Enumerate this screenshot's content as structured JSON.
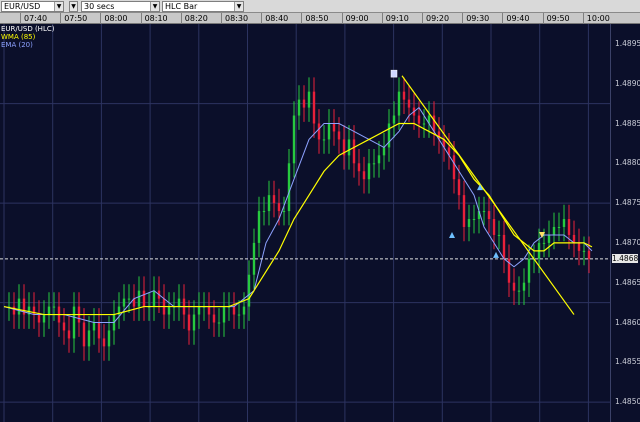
{
  "toolbar": {
    "symbol": "EUR/USD",
    "interval": "30 secs",
    "chart_style": "HLC Bar"
  },
  "legend": [
    {
      "label": "EUR/USD (HLC)",
      "color": "#ffffff"
    },
    {
      "label": "WMA (85)",
      "color": "#ffff00"
    },
    {
      "label": "EMA (20)",
      "color": "#8da2ff"
    }
  ],
  "current_price": "1.4868",
  "chart_data": {
    "type": "line",
    "time_labels": [
      "07:40",
      "07:50",
      "08:00",
      "08:10",
      "08:20",
      "08:30",
      "08:40",
      "08:50",
      "09:00",
      "09:10",
      "09:20",
      "09:30",
      "09:40",
      "09:50",
      "10:00"
    ],
    "price_labels": [
      "1.4895",
      "1.4890",
      "1.4885",
      "1.4880",
      "1.4875",
      "1.4870",
      "1.4865",
      "1.4860",
      "1.4855",
      "1.4850"
    ],
    "ylim": [
      1.48475,
      1.48975
    ],
    "series": [
      {
        "name": "EUR/USD (HLC)",
        "color": "#ffffff",
        "x": [
          0,
          5,
          10,
          15,
          20,
          25,
          30,
          35,
          40,
          45,
          50,
          55,
          60,
          65,
          70,
          75,
          80,
          85,
          90,
          95,
          100,
          105,
          110,
          115,
          120,
          125,
          130,
          135,
          140,
          145,
          150,
          155,
          160,
          165,
          170,
          175,
          180,
          185,
          190,
          195,
          200,
          205,
          210,
          215,
          220,
          225,
          230,
          235,
          240,
          245,
          250,
          255,
          260,
          265,
          270,
          275,
          280,
          285,
          290,
          295,
          300,
          305,
          310,
          315,
          320,
          325,
          330,
          335,
          340,
          345,
          350,
          355,
          360,
          365,
          370,
          375,
          380,
          385,
          390,
          395,
          400,
          405,
          410,
          415,
          420,
          425,
          430,
          435,
          440,
          445,
          450,
          455,
          460,
          465,
          470,
          475,
          480,
          485,
          490,
          495,
          500,
          505,
          510,
          515,
          520,
          525,
          530,
          535,
          540,
          545,
          550,
          555,
          560,
          565,
          570,
          575,
          580,
          585
        ],
        "y": [
          1.4862,
          1.4862,
          1.4861,
          1.4863,
          1.4861,
          1.4862,
          1.4861,
          1.486,
          1.4861,
          1.4862,
          1.4862,
          1.486,
          1.4859,
          1.4858,
          1.4862,
          1.486,
          1.4857,
          1.4859,
          1.486,
          1.4858,
          1.4857,
          1.4859,
          1.4861,
          1.4862,
          1.4863,
          1.4863,
          1.4862,
          1.4864,
          1.4862,
          1.4862,
          1.4864,
          1.4863,
          1.4861,
          1.4862,
          1.4862,
          1.4863,
          1.4861,
          1.4859,
          1.4861,
          1.4862,
          1.4862,
          1.4861,
          1.486,
          1.486,
          1.4862,
          1.4862,
          1.4861,
          1.4861,
          1.4862,
          1.4866,
          1.487,
          1.4874,
          1.4874,
          1.4876,
          1.4875,
          1.4874,
          1.4874,
          1.488,
          1.4886,
          1.4888,
          1.4887,
          1.4889,
          1.4885,
          1.4883,
          1.4883,
          1.4885,
          1.4884,
          1.4883,
          1.4881,
          1.4883,
          1.488,
          1.4879,
          1.4878,
          1.488,
          1.488,
          1.4881,
          1.4882,
          1.4885,
          1.4886,
          1.4889,
          1.4888,
          1.4887,
          1.4886,
          1.4885,
          1.4885,
          1.4886,
          1.4884,
          1.4883,
          1.4882,
          1.4881,
          1.4878,
          1.4876,
          1.4872,
          1.4873,
          1.4873,
          1.4874,
          1.4874,
          1.4873,
          1.4871,
          1.4871,
          1.4868,
          1.4865,
          1.4864,
          1.4864,
          1.4865,
          1.4868,
          1.4868,
          1.487,
          1.487,
          1.4871,
          1.4872,
          1.4872,
          1.4873,
          1.4871,
          1.487,
          1.4869,
          1.4869,
          1.4868
        ]
      },
      {
        "name": "WMA (85)",
        "color": "#ffff00",
        "x": [
          0,
          40,
          80,
          110,
          140,
          170,
          200,
          225,
          245,
          260,
          275,
          290,
          305,
          320,
          335,
          350,
          365,
          380,
          395,
          410,
          425,
          440,
          455,
          470,
          485,
          500,
          510,
          520,
          530,
          540,
          550,
          560,
          570,
          580,
          588
        ],
        "y": [
          1.4862,
          1.4861,
          1.4861,
          1.4861,
          1.4862,
          1.4862,
          1.4862,
          1.4862,
          1.4863,
          1.4866,
          1.4869,
          1.4873,
          1.4876,
          1.4879,
          1.4881,
          1.4882,
          1.4883,
          1.4884,
          1.4885,
          1.4885,
          1.4884,
          1.4883,
          1.4881,
          1.4878,
          1.4876,
          1.4873,
          1.4871,
          1.487,
          1.4869,
          1.4869,
          1.487,
          1.487,
          1.487,
          1.487,
          1.48695
        ]
      },
      {
        "name": "EMA (20)",
        "color": "#8da2ff",
        "x": [
          0,
          30,
          60,
          90,
          110,
          130,
          150,
          170,
          190,
          210,
          230,
          250,
          262,
          275,
          290,
          305,
          320,
          335,
          350,
          365,
          380,
          395,
          405,
          415,
          425,
          440,
          455,
          470,
          480,
          490,
          500,
          510,
          520,
          530,
          540,
          550,
          560,
          570,
          580,
          588
        ],
        "y": [
          1.4862,
          1.4861,
          1.4861,
          1.486,
          1.486,
          1.4863,
          1.4864,
          1.4862,
          1.4862,
          1.4862,
          1.4862,
          1.4864,
          1.487,
          1.4873,
          1.4878,
          1.4883,
          1.4885,
          1.4885,
          1.4884,
          1.4883,
          1.4882,
          1.4884,
          1.4886,
          1.4887,
          1.4885,
          1.4882,
          1.4879,
          1.4876,
          1.4872,
          1.487,
          1.4868,
          1.4867,
          1.4868,
          1.487,
          1.4871,
          1.4871,
          1.4871,
          1.487,
          1.487,
          1.4869
        ]
      },
      {
        "name": "trendline",
        "color": "#ffff00",
        "x": [
          398,
          570
        ],
        "y": [
          1.4891,
          1.4861
        ]
      }
    ],
    "grid": true,
    "legend_position": "top-left"
  }
}
